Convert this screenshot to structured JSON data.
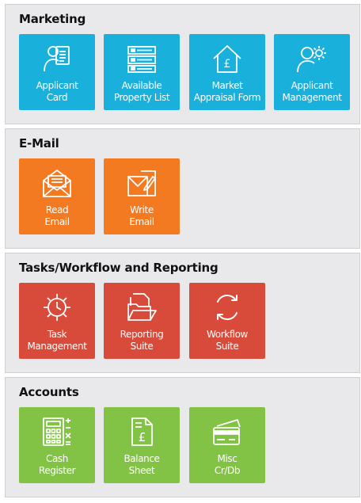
{
  "colors": {
    "marketing": "#19b0dc",
    "email": "#f47a22",
    "tasks": "#d84b3a",
    "accounts": "#82c346",
    "panel_bg": "#e9e9eb"
  },
  "sections": {
    "marketing": {
      "title": "Marketing",
      "tiles": [
        {
          "label": "Applicant\nCard",
          "icon": "applicant-card-icon"
        },
        {
          "label": "Available\nProperty List",
          "icon": "property-list-icon"
        },
        {
          "label": "Market\nAppraisal Form",
          "icon": "house-pound-icon"
        },
        {
          "label": "Applicant\nManagement",
          "icon": "user-gear-icon"
        }
      ]
    },
    "email": {
      "title": "E-Mail",
      "tiles": [
        {
          "label": "Read\nEmail",
          "icon": "open-envelope-icon"
        },
        {
          "label": "Write\nEmail",
          "icon": "write-email-icon"
        }
      ]
    },
    "tasks": {
      "title": "Tasks/Workflow and Reporting",
      "tiles": [
        {
          "label": "Task\nManagement",
          "icon": "gear-clock-icon"
        },
        {
          "label": "Reporting\nSuite",
          "icon": "folder-documents-icon"
        },
        {
          "label": "Workflow\nSuite",
          "icon": "refresh-arrows-icon"
        }
      ]
    },
    "accounts": {
      "title": "Accounts",
      "tiles": [
        {
          "label": "Cash\nRegister",
          "icon": "calculator-icon"
        },
        {
          "label": "Balance\nSheet",
          "icon": "pound-document-icon"
        },
        {
          "label": "Misc\nCr/Db",
          "icon": "credit-cards-icon"
        }
      ]
    }
  }
}
